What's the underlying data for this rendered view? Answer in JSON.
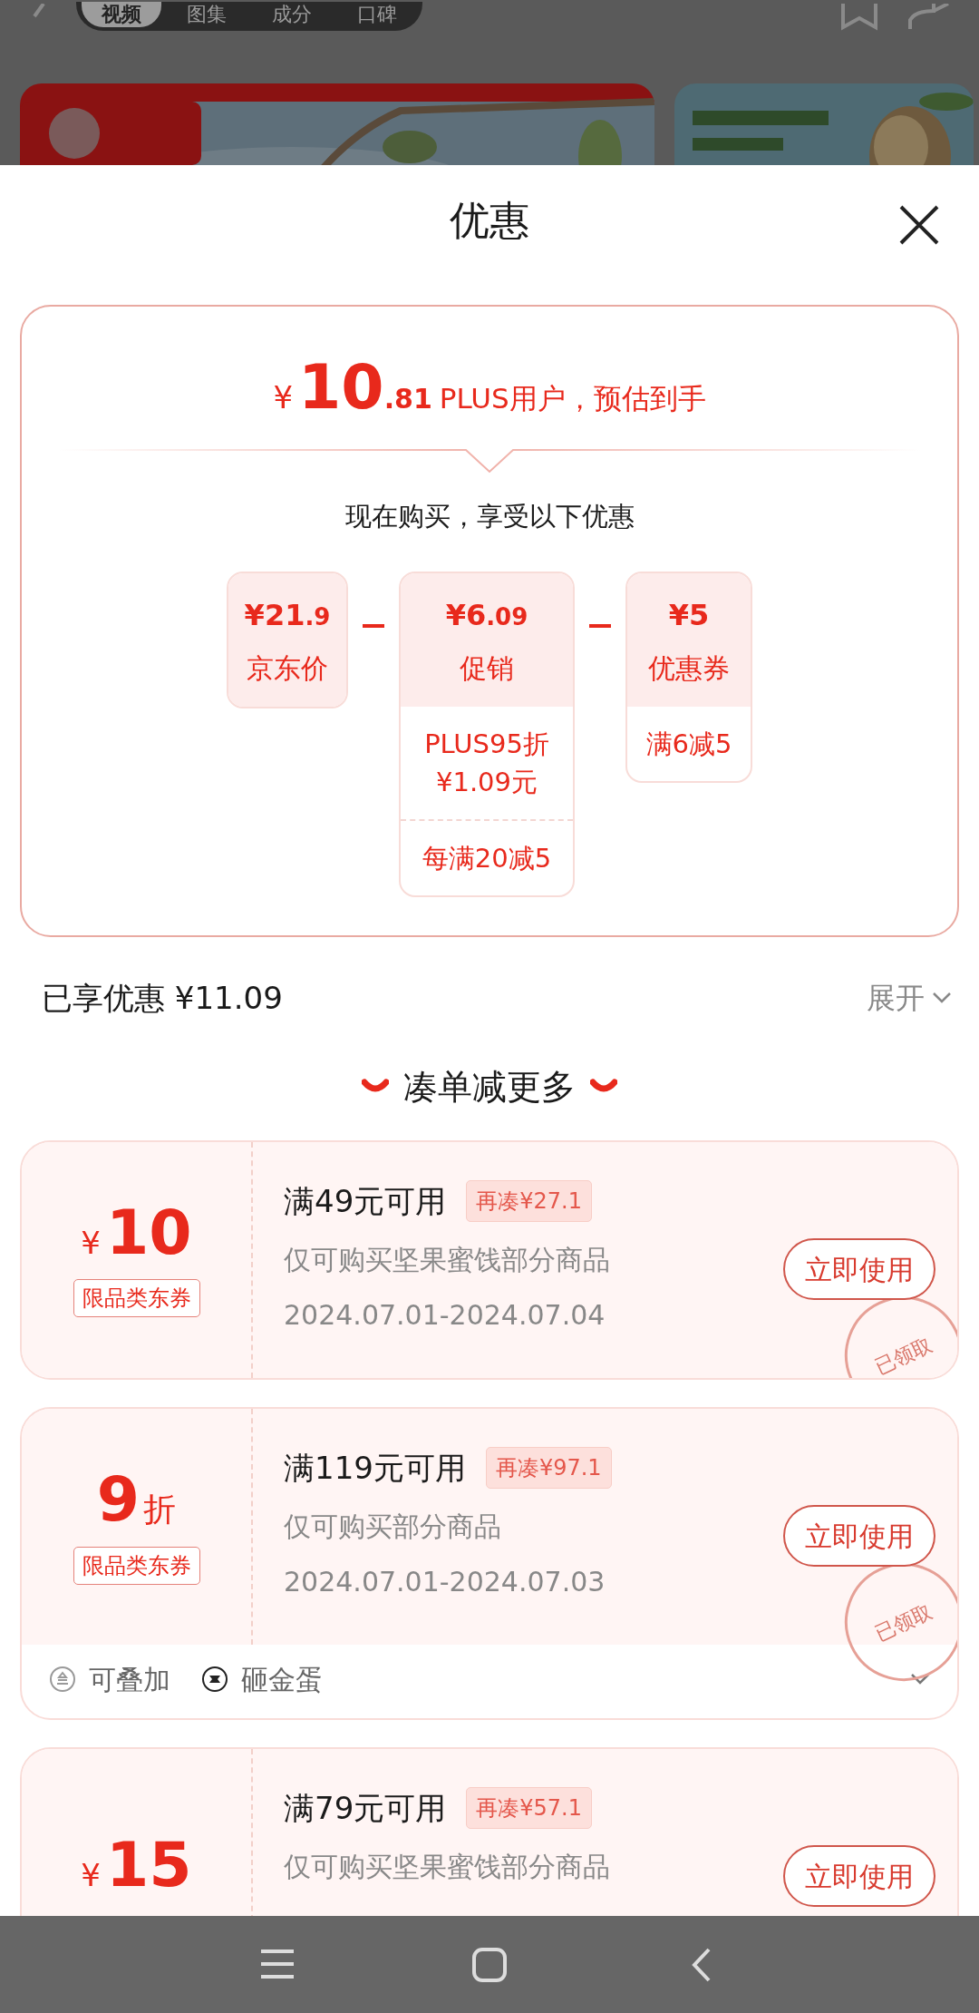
{
  "background": {
    "tabs": [
      {
        "label": "视频",
        "selected": true
      },
      {
        "label": "图集",
        "selected": false
      },
      {
        "label": "成分",
        "selected": false
      },
      {
        "label": "口碑",
        "selected": false
      }
    ]
  },
  "sheet": {
    "title": "优惠"
  },
  "estimate": {
    "currency": "¥",
    "integer": "10",
    "decimal": ".81",
    "label": "PLUS用户，预估到手"
  },
  "breakdown_title": "现在购买，享受以下优惠",
  "breakdown": [
    {
      "currency": "¥",
      "integer": "21",
      "decimal": ".9",
      "label": "京东价"
    },
    {
      "currency": "¥",
      "integer": "6",
      "decimal": ".09",
      "label": "促销",
      "details": [
        [
          "PLUS95折",
          "¥1.09元"
        ],
        [
          "每满20减5"
        ]
      ]
    },
    {
      "currency": "¥",
      "integer": "5",
      "label": "优惠券",
      "details": [
        [
          "满6减5"
        ]
      ]
    }
  ],
  "saved": {
    "label": "已享优惠 ¥11.09",
    "toggle": "展开"
  },
  "section_title": "凑单减更多",
  "coupons": [
    {
      "kind": "amount",
      "currency": "¥",
      "value": "10",
      "tag": "限品类东券",
      "threshold": "满49元可用",
      "gap": "再凑¥27.1",
      "scope": "仅可购买坚果蜜饯部分商品",
      "dates": "2024.07.01-2024.07.04",
      "button": "立即使用",
      "claimed": true,
      "stamp": "已领取"
    },
    {
      "kind": "discount",
      "value": "9",
      "unit": "折",
      "tag": "限品类东券",
      "threshold": "满119元可用",
      "gap": "再凑¥97.1",
      "scope": "仅可购买部分商品",
      "dates": "2024.07.01-2024.07.03",
      "button": "立即使用",
      "claimed": true,
      "stamp": "已领取",
      "features": [
        "可叠加",
        "砸金蛋"
      ]
    },
    {
      "kind": "amount",
      "currency": "¥",
      "value": "15",
      "threshold": "满79元可用",
      "gap": "再凑¥57.1",
      "scope": "仅可购买坚果蜜饯部分商品",
      "button": "立即使用"
    }
  ]
}
